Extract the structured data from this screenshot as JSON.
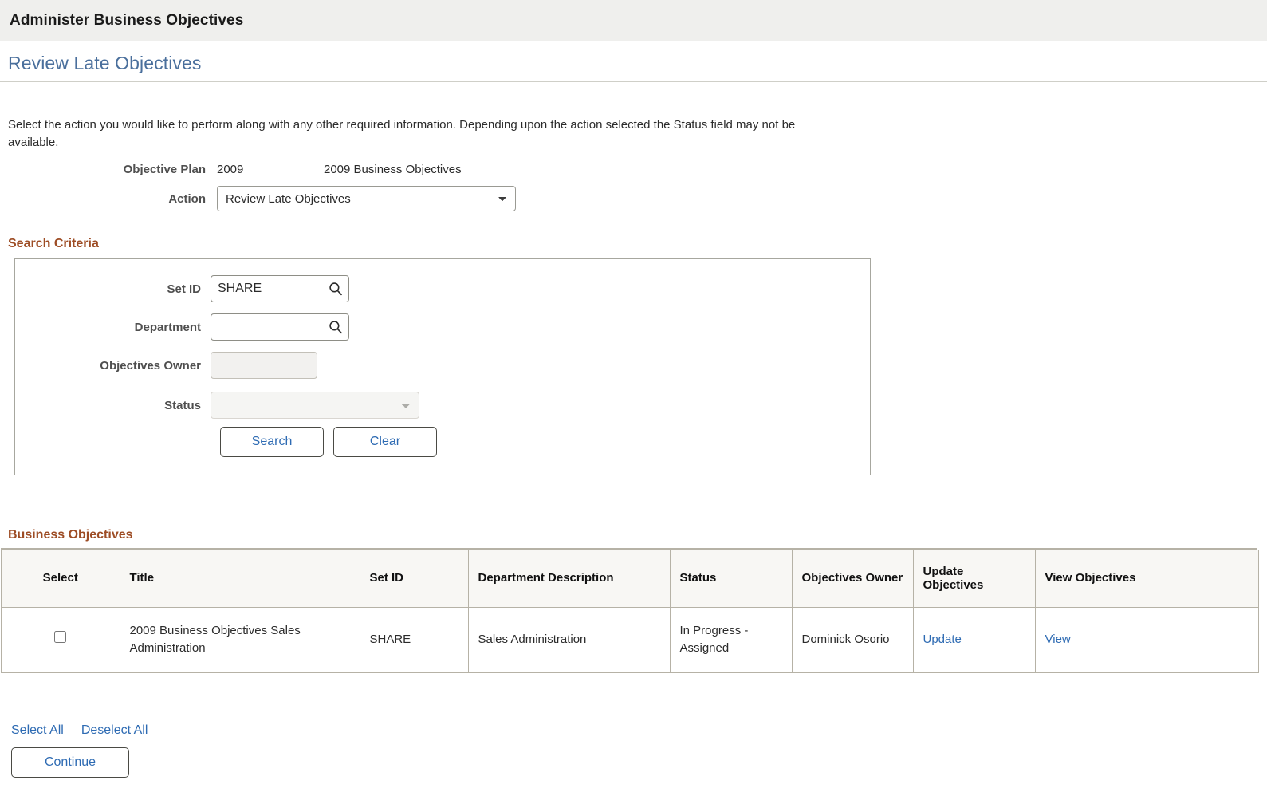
{
  "app": {
    "title": "Administer Business Objectives"
  },
  "page": {
    "title": "Review Late Objectives",
    "instructions": "Select the action you would like to perform along with any other required information. Depending upon the action selected the Status field may not be available."
  },
  "form": {
    "objective_plan_label": "Objective Plan",
    "objective_plan_code": "2009",
    "objective_plan_description": "2009 Business Objectives",
    "action_label": "Action",
    "action_value": "Review Late Objectives",
    "action_options": [
      "Review Late Objectives"
    ]
  },
  "search_criteria": {
    "heading": "Search Criteria",
    "set_id_label": "Set ID",
    "set_id_value": "SHARE",
    "set_id_lookup_icon": "search-icon",
    "department_label": "Department",
    "department_value": "",
    "department_lookup_icon": "search-icon",
    "objectives_owner_label": "Objectives Owner",
    "objectives_owner_value": "",
    "status_label": "Status",
    "status_value": "",
    "status_options": [
      ""
    ],
    "search_button": "Search",
    "clear_button": "Clear"
  },
  "results": {
    "heading": "Business Objectives",
    "columns": [
      "Select",
      "Title",
      "Set ID",
      "Department Description",
      "Status",
      "Objectives Owner",
      "Update Objectives",
      "View Objectives"
    ],
    "rows": [
      {
        "selected": false,
        "title": "2009 Business Objectives Sales Administration",
        "set_id": "SHARE",
        "department_description": "Sales Administration",
        "status": "In Progress - Assigned",
        "objectives_owner": "Dominick Osorio",
        "update_link": "Update",
        "view_link": "View"
      }
    ]
  },
  "footer": {
    "select_all": "Select All",
    "deselect_all": "Deselect All",
    "continue_button": "Continue"
  },
  "colors": {
    "header_bar": "#efefed",
    "page_title": "#4a6f9c",
    "section_heading": "#9d4c24",
    "link": "#2e6bb3",
    "grid_header_bg": "#f8f7f4",
    "grid_border": "#b6b2a6"
  }
}
